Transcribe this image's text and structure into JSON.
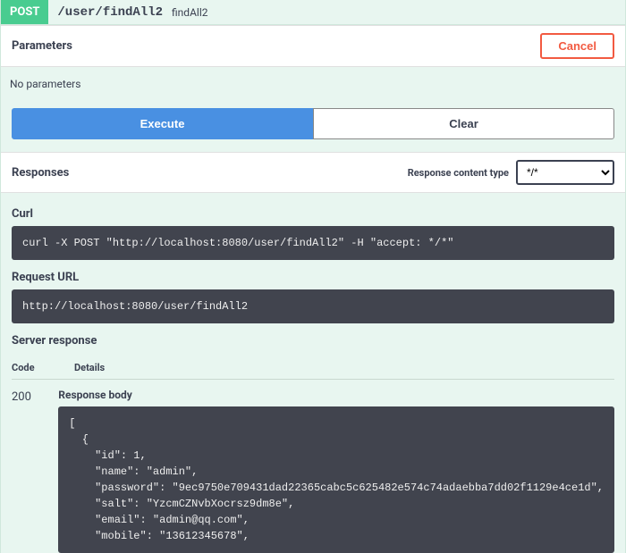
{
  "endpoint": {
    "method": "POST",
    "path": "/user/findAll2",
    "summary": "findAll2"
  },
  "parameters": {
    "heading": "Parameters",
    "cancel": "Cancel",
    "none": "No parameters",
    "execute": "Execute",
    "clear": "Clear"
  },
  "responses": {
    "heading": "Responses",
    "content_type_label": "Response content type",
    "content_type_value": "*/*",
    "curl_heading": "Curl",
    "curl": "curl -X POST \"http://localhost:8080/user/findAll2\" -H \"accept: */*\"",
    "request_url_heading": "Request URL",
    "request_url": "http://localhost:8080/user/findAll2",
    "server_response_heading": "Server response",
    "col_code": "Code",
    "col_details": "Details",
    "status_code": "200",
    "response_body_heading": "Response body",
    "response_body": "[\n  {\n    \"id\": 1,\n    \"name\": \"admin\",\n    \"password\": \"9ec9750e709431dad22365cabc5c625482e574c74adaebba7dd02f1129e4ce1d\",\n    \"salt\": \"YzcmCZNvbXocrsz9dm8e\",\n    \"email\": \"admin@qq.com\",\n    \"mobile\": \"13612345678\","
  }
}
